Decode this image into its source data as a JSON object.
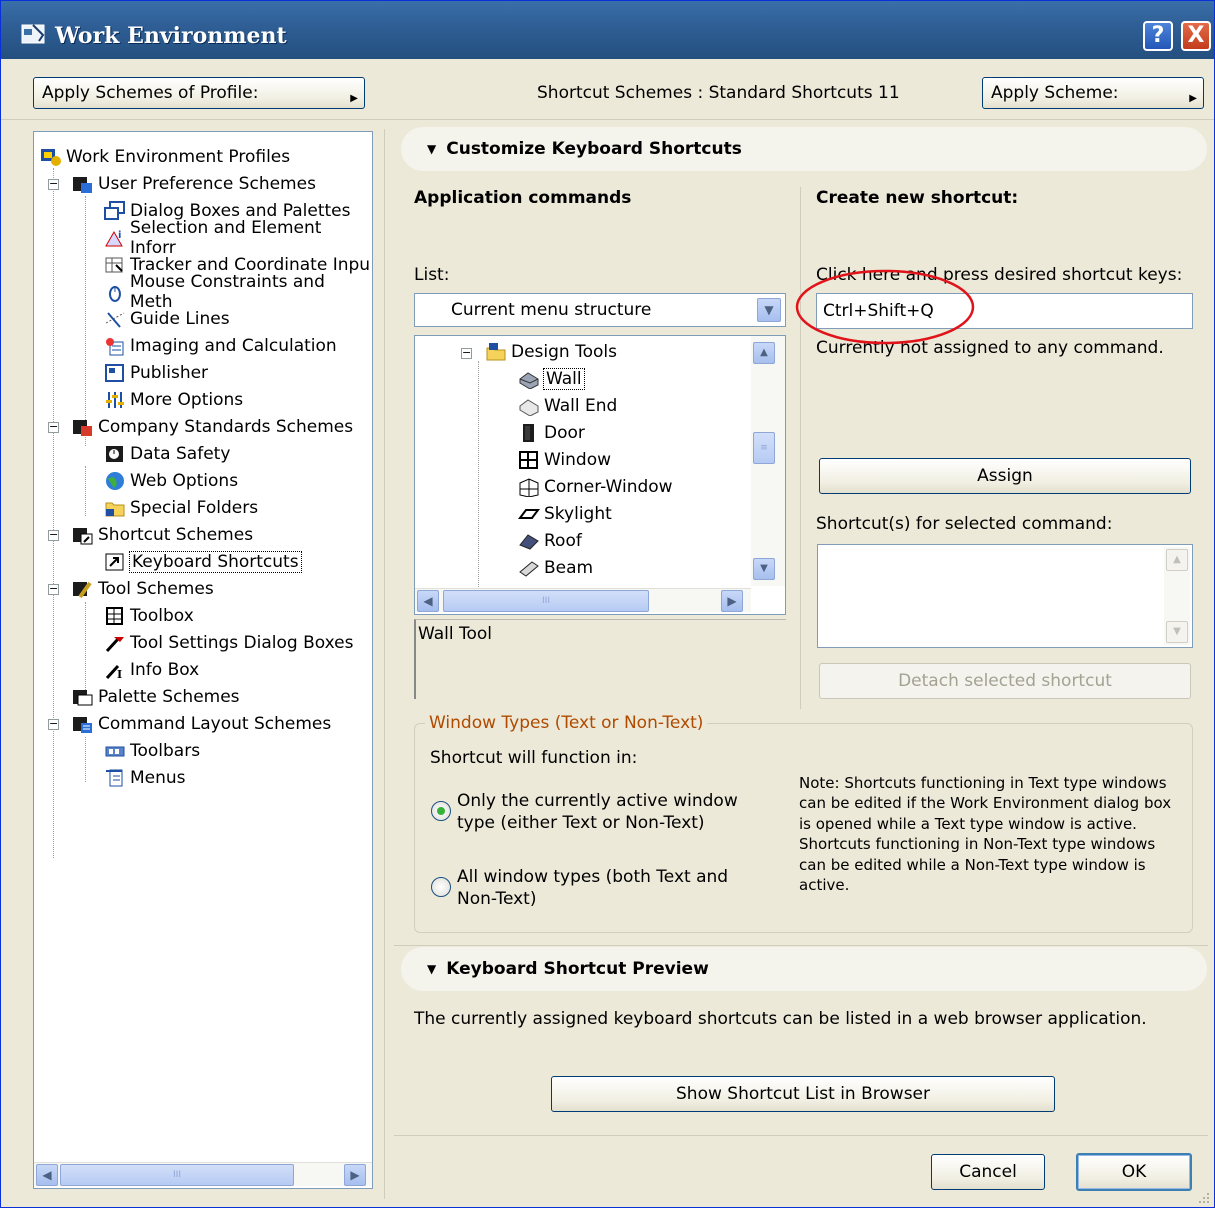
{
  "window": {
    "title": "Work Environment",
    "help_label": "?",
    "close_label": "X"
  },
  "top": {
    "apply_profile_label": "Apply Schemes of Profile:",
    "current_scheme_text": "Shortcut Schemes : Standard Shortcuts 11",
    "apply_scheme_label": "Apply Scheme:"
  },
  "tree": {
    "items": [
      {
        "label": "Work Environment Profiles"
      },
      {
        "label": "User Preference Schemes"
      },
      {
        "label": "Dialog Boxes and Palettes"
      },
      {
        "label": "Selection and Element Inforr"
      },
      {
        "label": "Tracker and Coordinate Inpu"
      },
      {
        "label": "Mouse Constraints and Meth"
      },
      {
        "label": "Guide Lines"
      },
      {
        "label": "Imaging and Calculation"
      },
      {
        "label": "Publisher"
      },
      {
        "label": "More Options"
      },
      {
        "label": "Company Standards Schemes"
      },
      {
        "label": "Data Safety"
      },
      {
        "label": "Web Options"
      },
      {
        "label": "Special Folders"
      },
      {
        "label": "Shortcut Schemes"
      },
      {
        "label": "Keyboard Shortcuts"
      },
      {
        "label": "Tool Schemes"
      },
      {
        "label": "Toolbox"
      },
      {
        "label": "Tool Settings Dialog Boxes"
      },
      {
        "label": "Info Box"
      },
      {
        "label": "Palette Schemes"
      },
      {
        "label": "Command Layout Schemes"
      },
      {
        "label": "Toolbars"
      },
      {
        "label": "Menus"
      }
    ],
    "expander": "−",
    "scroll_thumb": "III"
  },
  "customize": {
    "heading": "Customize Keyboard Shortcuts",
    "app_commands_heading": "Application commands",
    "list_label": "List:",
    "list_value": "Current menu structure",
    "commands": [
      {
        "label": "Design Tools"
      },
      {
        "label": "Wall"
      },
      {
        "label": "Wall End"
      },
      {
        "label": "Door"
      },
      {
        "label": "Window"
      },
      {
        "label": "Corner-Window"
      },
      {
        "label": "Skylight"
      },
      {
        "label": "Roof"
      },
      {
        "label": "Beam"
      }
    ],
    "description": "Wall Tool",
    "create_heading": "Create new shortcut:",
    "press_label": "Click here and press desired shortcut keys:",
    "shortcut_value": "Ctrl+Shift+Q",
    "assign_status": "Currently not assigned to any command.",
    "assign_label": "Assign",
    "shortcuts_label": "Shortcut(s) for selected command:",
    "detach_label": "Detach selected shortcut"
  },
  "window_types": {
    "legend": "Window Types (Text or Non-Text)",
    "function_label": "Shortcut will function in:",
    "option1": "Only the currently active window type (either Text or Non-Text)",
    "option2": "All window types (both Text and Non-Text)",
    "note": "Note: Shortcuts functioning in Text type windows can be edited if the Work Environment dialog box is opened while a Text type window is active. Shortcuts functioning in Non-Text type windows can be edited while a Non-Text type window is active."
  },
  "preview": {
    "heading": "Keyboard Shortcut Preview",
    "description": "The currently assigned keyboard shortcuts can be listed in a web browser application.",
    "show_label": "Show Shortcut List in Browser"
  },
  "footer": {
    "cancel_label": "Cancel",
    "ok_label": "OK"
  },
  "colors": {
    "title_bar": "#2f5f96",
    "annotation_circle": "#e0131a",
    "group_legend": "#b04a00",
    "radio_selected": "#36b23a"
  }
}
